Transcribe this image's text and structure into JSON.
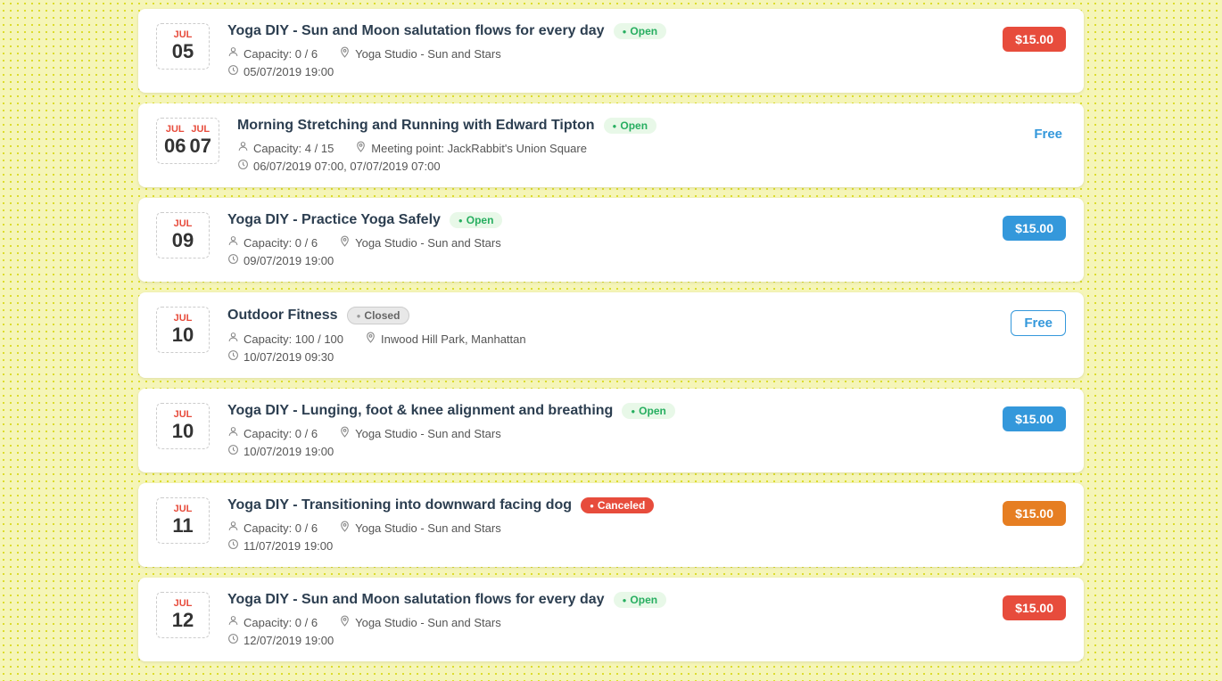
{
  "events": [
    {
      "id": 1,
      "month": "JUL",
      "day": "05",
      "title": "Yoga DIY - Sun and Moon salutation flows for every day",
      "status": "Open",
      "status_type": "open",
      "capacity": "0 / 6",
      "location": "Yoga Studio - Sun and Stars",
      "datetime": "05/07/2019 19:00",
      "price": "$15.00",
      "price_type": "red",
      "double_date": false
    },
    {
      "id": 2,
      "month": "JUL",
      "day": "06",
      "month2": "JUL",
      "day2": "07",
      "title": "Morning Stretching and Running with Edward Tipton",
      "status": "Open",
      "status_type": "open",
      "capacity": "4 / 15",
      "location": "Meeting point: JackRabbit's Union Square",
      "datetime": "06/07/2019 07:00, 07/07/2019 07:00",
      "price": "Free",
      "price_type": "free-plain",
      "double_date": true
    },
    {
      "id": 3,
      "month": "JUL",
      "day": "09",
      "title": "Yoga DIY - Practice Yoga Safely",
      "status": "Open",
      "status_type": "open",
      "capacity": "0 / 6",
      "location": "Yoga Studio - Sun and Stars",
      "datetime": "09/07/2019 19:00",
      "price": "$15.00",
      "price_type": "blue",
      "double_date": false
    },
    {
      "id": 4,
      "month": "JUL",
      "day": "10",
      "title": "Outdoor Fitness",
      "status": "Closed",
      "status_type": "closed",
      "capacity": "100 / 100",
      "location": "Inwood Hill Park, Manhattan",
      "datetime": "10/07/2019 09:30",
      "price": "Free",
      "price_type": "free-outline",
      "double_date": false
    },
    {
      "id": 5,
      "month": "JUL",
      "day": "10",
      "title": "Yoga DIY - Lunging, foot & knee alignment and breathing",
      "status": "Open",
      "status_type": "open",
      "capacity": "0 / 6",
      "location": "Yoga Studio - Sun and Stars",
      "datetime": "10/07/2019 19:00",
      "price": "$15.00",
      "price_type": "blue-teal",
      "double_date": false
    },
    {
      "id": 6,
      "month": "JUL",
      "day": "11",
      "title": "Yoga DIY - Transitioning into downward facing dog",
      "status": "Canceled",
      "status_type": "canceled",
      "capacity": "0 / 6",
      "location": "Yoga Studio - Sun and Stars",
      "datetime": "11/07/2019 19:00",
      "price": "$15.00",
      "price_type": "orange",
      "double_date": false
    },
    {
      "id": 7,
      "month": "JUL",
      "day": "12",
      "title": "Yoga DIY - Sun and Moon salutation flows for every day",
      "status": "Open",
      "status_type": "open",
      "capacity": "0 / 6",
      "location": "Yoga Studio - Sun and Stars",
      "datetime": "12/07/2019 19:00",
      "price": "$15.00",
      "price_type": "red",
      "double_date": false
    }
  ],
  "icons": {
    "person": "👤",
    "location": "📍",
    "clock": "🕐"
  }
}
